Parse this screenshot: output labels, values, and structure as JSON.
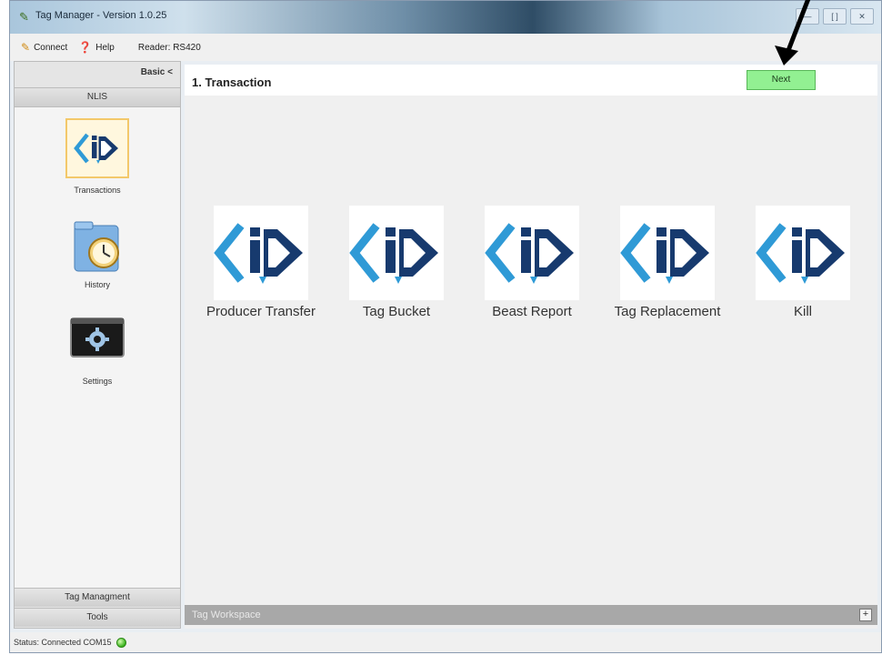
{
  "window": {
    "title": "Tag Manager - Version 1.0.25",
    "controls": [
      "—",
      "[ ]",
      "✕"
    ]
  },
  "menu": {
    "connect": "Connect",
    "help": "Help",
    "reader": "Reader: RS420"
  },
  "sidebar": {
    "toggle": "Basic <",
    "header": "NLIS",
    "items": [
      {
        "label": "Transactions",
        "icon": "cid-logo-icon",
        "selected": true
      },
      {
        "label": "History",
        "icon": "clock-folder-icon",
        "selected": false
      },
      {
        "label": "Settings",
        "icon": "gear-icon",
        "selected": false
      }
    ],
    "footer": [
      "Tag Managment",
      "Tools"
    ]
  },
  "main": {
    "step_title": "1. Transaction",
    "next_label": "Next",
    "transactions": [
      {
        "label": "Producer Transfer"
      },
      {
        "label": "Tag Bucket"
      },
      {
        "label": "Beast Report"
      },
      {
        "label": "Tag Replacement"
      },
      {
        "label": "Kill"
      }
    ],
    "workspace_label": "Tag Workspace",
    "expand_label": "+"
  },
  "status": {
    "text": "Status: Connected COM15"
  },
  "colors": {
    "logo_dark": "#173a6e",
    "logo_light": "#2f9ad6",
    "next_bg": "#92f092"
  }
}
